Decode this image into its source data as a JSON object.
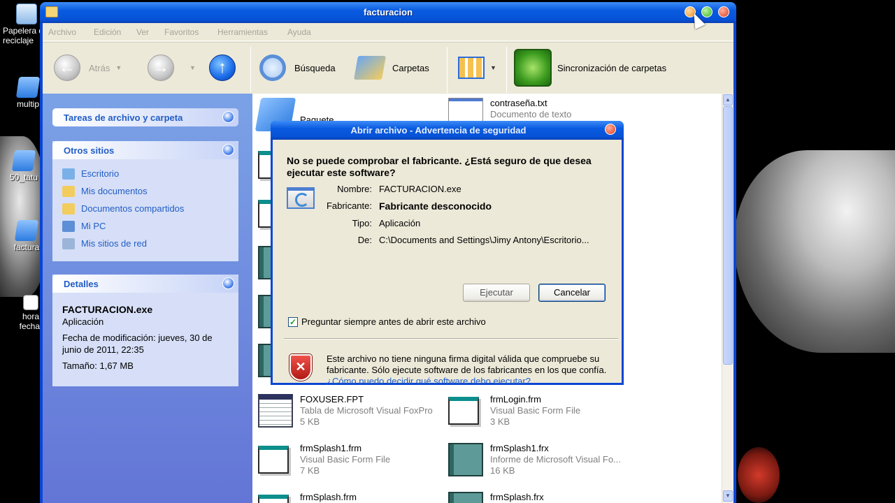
{
  "desktop": {
    "icons": [
      {
        "label": "Papelera de\nreciclaje",
        "icon": "recycle-bin-icon"
      },
      {
        "label": "multip",
        "icon": "folder-icon"
      },
      {
        "label": "50_tatu",
        "icon": "folder-icon"
      },
      {
        "label": "factura",
        "icon": "folder-icon"
      },
      {
        "label": "hora\nfecha.",
        "icon": "file-icon"
      }
    ]
  },
  "window": {
    "title": "facturacion",
    "menu": [
      "Archivo",
      "Edición",
      "Ver",
      "Favoritos",
      "Herramientas",
      "Ayuda"
    ],
    "toolbar": {
      "back_label": "Atrás",
      "search_label": "Búsqueda",
      "folders_label": "Carpetas",
      "sync_label": "Sincronización de carpetas"
    }
  },
  "leftpane": {
    "tasks_title": "Tareas de archivo y carpeta",
    "other_title": "Otros sitios",
    "other_links": [
      "Escritorio",
      "Mis documentos",
      "Documentos compartidos",
      "Mi PC",
      "Mis sitios de red"
    ],
    "details_title": "Detalles",
    "details": {
      "name": "FACTURACION.exe",
      "type": "Aplicación",
      "modified": "Fecha de modificación: jueves, 30 de junio de 2011, 22:35",
      "size": "Tamaño: 1,67 MB"
    }
  },
  "files": {
    "paquete": "Paquete",
    "password_name": "contraseña.txt",
    "password_type": "Documento de texto",
    "foxuser_name": "FOXUSER.FPT",
    "foxuser_type": "Tabla de Microsoft Visual FoxPro",
    "foxuser_size": "5 KB",
    "frmlogin_name": "frmLogin.frm",
    "frmlogin_type": "Visual Basic Form File",
    "frmlogin_size": "3 KB",
    "frmsplash1frm_name": "frmSplash1.frm",
    "frmsplash1frm_type": "Visual Basic Form File",
    "frmsplash1frm_size": "7 KB",
    "frmsplash1frx_name": "frmSplash1.frx",
    "frmsplash1frx_type": "Informe de Microsoft Visual Fo...",
    "frmsplash1frx_size": "16 KB",
    "frmsplashfrm_name": "frmSplash.frm",
    "frmsplashfrx_name": "frmSplash.frx"
  },
  "dialog": {
    "title": "Abrir archivo - Advertencia de seguridad",
    "question": "No se puede comprobar el fabricante. ¿Está seguro de que desea ejecutar este software?",
    "name_label": "Nombre:",
    "name_value": "FACTURACION.exe",
    "publisher_label": "Fabricante:",
    "publisher_value": "Fabricante desconocido",
    "type_label": "Tipo:",
    "type_value": "Aplicación",
    "from_label": "De:",
    "from_value": "C:\\Documents and Settings\\Jimy Antony\\Escritorio...",
    "run_button": "Ejecutar",
    "cancel_button": "Cancelar",
    "checkbox_label": "Preguntar siempre antes de abrir este archivo",
    "checkbox_checked": true,
    "warning_text": "Este archivo no tiene ninguna firma digital válida que compruebe su fabricante.  Sólo ejecute software de los fabricantes en los que confía.",
    "help_link": "¿Cómo puedo decidir qué software debo ejecutar?"
  }
}
